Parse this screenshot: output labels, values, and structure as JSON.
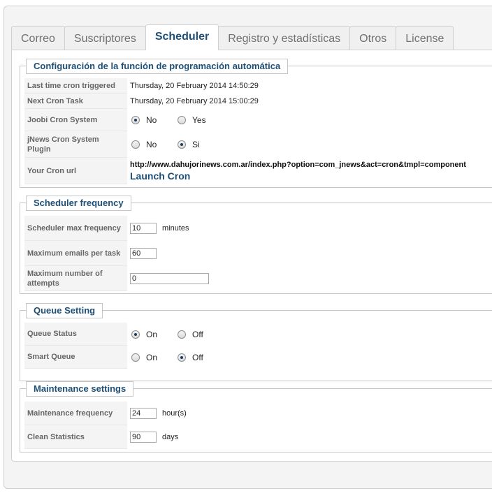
{
  "tabs": [
    {
      "label": "Correo"
    },
    {
      "label": "Suscriptores"
    },
    {
      "label": "Scheduler"
    },
    {
      "label": "Registro y estadísticas"
    },
    {
      "label": "Otros"
    },
    {
      "label": "License"
    }
  ],
  "active_tab": "Scheduler",
  "auto_config": {
    "legend": "Configuración de la función de programación automática",
    "last_cron": {
      "label": "Last time cron triggered",
      "value": "Thursday, 20 February 2014 14:50:29"
    },
    "next_cron": {
      "label": "Next Cron Task",
      "value": "Thursday, 20 February 2014 15:00:29"
    },
    "joobi_cron": {
      "label": "Joobi Cron System",
      "opt1": "No",
      "opt2": "Yes",
      "selected": "No"
    },
    "jnews_cron": {
      "label": "jNews Cron System Plugin",
      "opt1": "No",
      "opt2": "Si",
      "selected": "Si"
    },
    "cron_url": {
      "label": "Your Cron url",
      "url": "http://www.dahujorinews.com.ar/index.php?option=com_jnews&act=cron&tmpl=component",
      "launch": "Launch Cron"
    }
  },
  "frequency": {
    "legend": "Scheduler frequency",
    "max_freq": {
      "label": "Scheduler max frequency",
      "value": "10",
      "unit": "minutes"
    },
    "max_emails": {
      "label": "Maximum emails per task",
      "value": "60"
    },
    "max_attempts": {
      "label": "Maximum number of attempts",
      "value": "0"
    }
  },
  "queue": {
    "legend": "Queue Setting",
    "status": {
      "label": "Queue Status",
      "opt1": "On",
      "opt2": "Off",
      "selected": "On"
    },
    "smart": {
      "label": "Smart Queue",
      "opt1": "On",
      "opt2": "Off",
      "selected": "Off"
    }
  },
  "maintenance": {
    "legend": "Maintenance settings",
    "freq": {
      "label": "Maintenance frequency",
      "value": "24",
      "unit": "hour(s)"
    },
    "clean": {
      "label": "Clean Statistics",
      "value": "90",
      "unit": "days"
    }
  },
  "colors": {
    "accent": "#1d4f77",
    "label_bg": "#f4f4f4",
    "border": "#c6c6c6"
  }
}
